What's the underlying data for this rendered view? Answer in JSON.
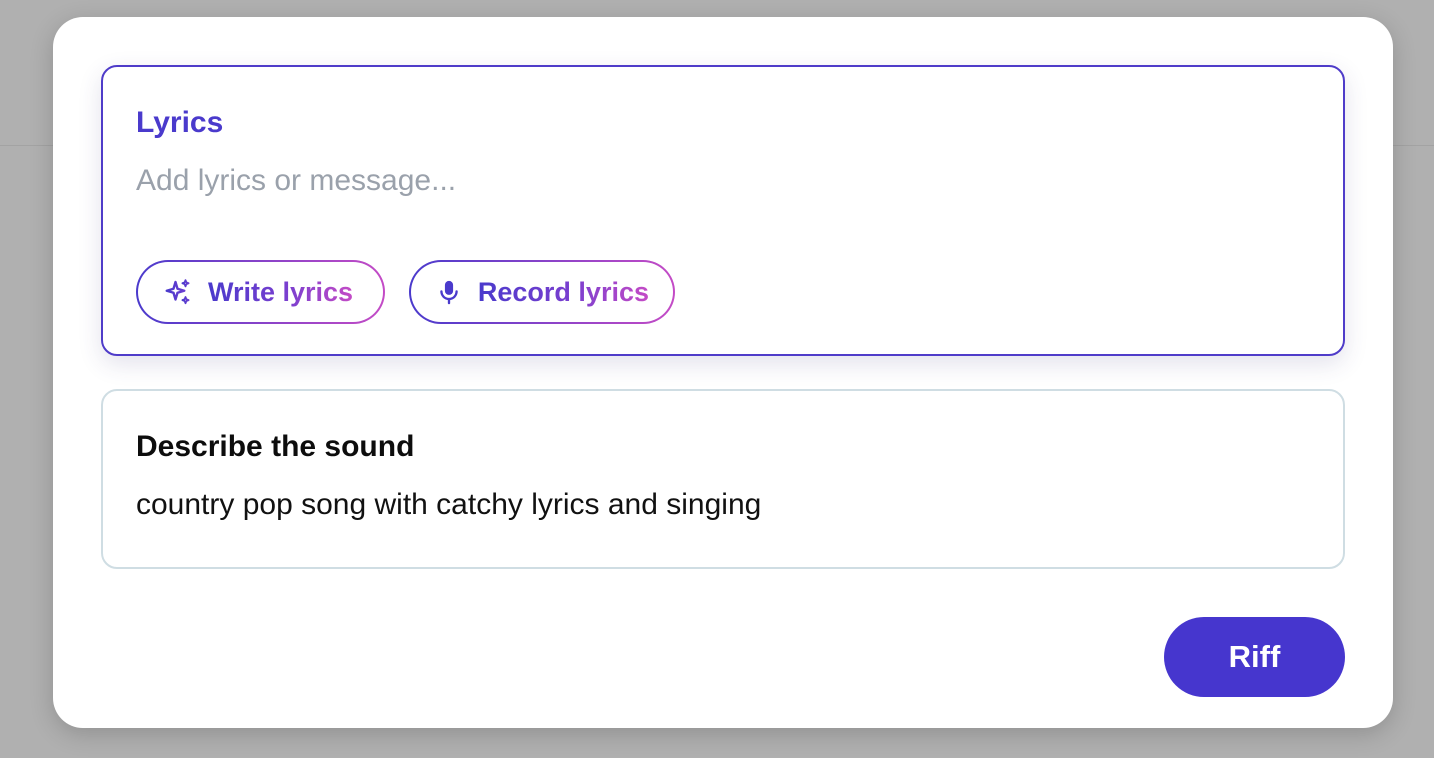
{
  "lyrics": {
    "label": "Lyrics",
    "value": "",
    "placeholder": "Add lyrics or message...",
    "write_button": {
      "label": "Write lyrics",
      "icon": "sparkles-icon"
    },
    "record_button": {
      "label": "Record lyrics",
      "icon": "microphone-icon"
    }
  },
  "sound": {
    "label": "Describe the sound",
    "value": "country pop song with catchy lyrics and singing"
  },
  "submit": {
    "label": "Riff"
  },
  "colors": {
    "accent": "#4636ce",
    "gradient_start": "#4a3acc",
    "gradient_end": "#c44bc6",
    "backdrop": "#b0b0b0"
  }
}
